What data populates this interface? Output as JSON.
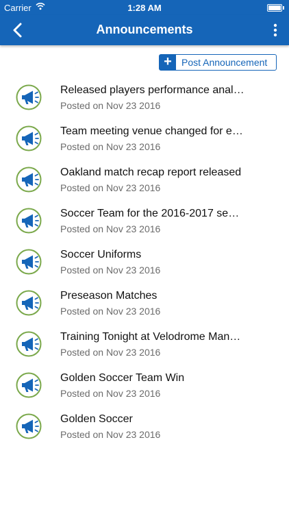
{
  "status_bar": {
    "carrier": "Carrier",
    "time": "1:28 AM"
  },
  "nav": {
    "title": "Announcements",
    "back_icon": "chevron-left-icon",
    "menu_icon": "more-vertical-icon"
  },
  "post_button": {
    "icon": "+",
    "label": "Post Announcement"
  },
  "colors": {
    "brand": "#1565b8",
    "icon_ring": "#7aa84a"
  },
  "announcements": [
    {
      "title": "Released players performance anal…",
      "posted": "Posted on Nov 23 2016"
    },
    {
      "title": "Team meeting venue changed for e…",
      "posted": "Posted on Nov 23 2016"
    },
    {
      "title": "Oakland match recap report released",
      "posted": "Posted on Nov 23 2016"
    },
    {
      "title": "Soccer Team for the 2016-2017 se…",
      "posted": "Posted on Nov 23 2016"
    },
    {
      "title": "Soccer Uniforms",
      "posted": "Posted on Nov 23 2016"
    },
    {
      "title": "Preseason Matches",
      "posted": "Posted on Nov 23 2016"
    },
    {
      "title": "Training Tonight at Velodrome Man…",
      "posted": "Posted on Nov 23 2016"
    },
    {
      "title": "Golden Soccer Team Win",
      "posted": "Posted on Nov 23 2016"
    },
    {
      "title": "Golden Soccer",
      "posted": "Posted on Nov 23 2016"
    }
  ]
}
